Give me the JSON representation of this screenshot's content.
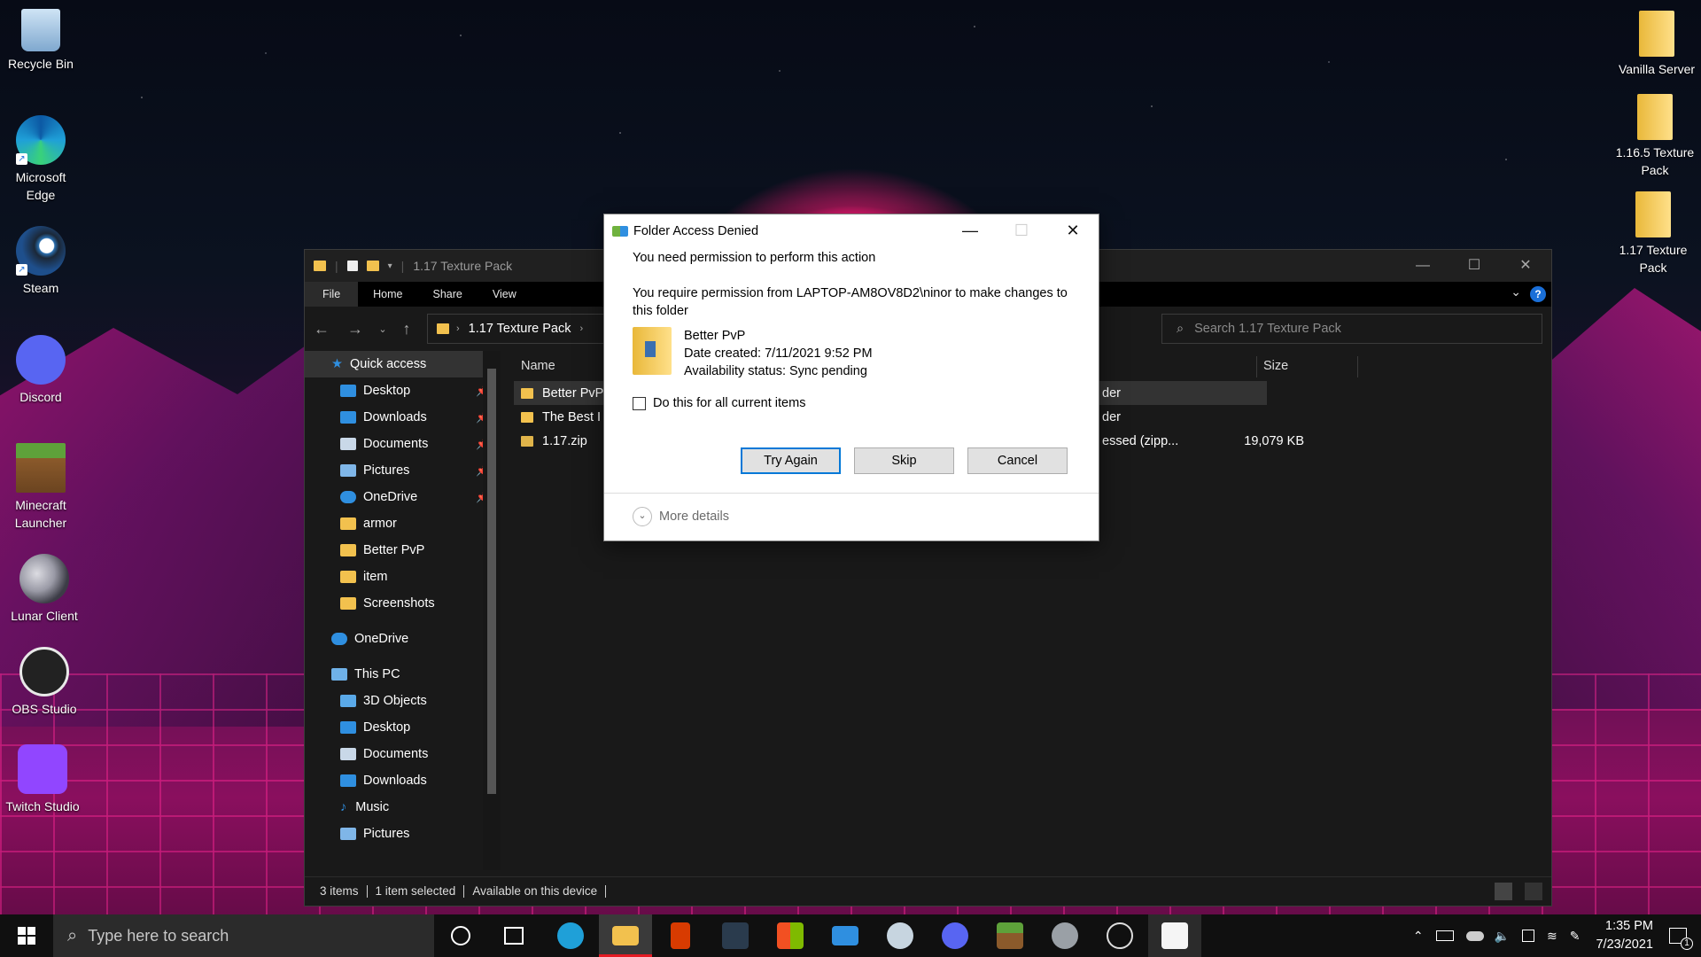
{
  "desktop": {
    "left_icons": [
      {
        "label": "Recycle Bin",
        "icon": "recycle-bin-icon",
        "color": "#9fc6e8"
      },
      {
        "label": "Microsoft Edge",
        "icon": "edge-icon",
        "color": "#1fa0d8"
      },
      {
        "label": "Steam",
        "icon": "steam-icon",
        "color": "#1b2838"
      },
      {
        "label": "Discord",
        "icon": "discord-icon",
        "color": "#5865f2"
      },
      {
        "label": "Minecraft Launcher",
        "icon": "minecraft-icon",
        "color": "#5a8f3a"
      },
      {
        "label": "Lunar Client",
        "icon": "lunar-client-icon",
        "color": "#3c3c46"
      },
      {
        "label": "OBS Studio",
        "icon": "obs-icon",
        "color": "#222222"
      },
      {
        "label": "Twitch Studio",
        "icon": "twitch-icon",
        "color": "#9146ff"
      }
    ],
    "right_icons": [
      {
        "label": "Vanilla Server",
        "icon": "folder-icon"
      },
      {
        "label": "1.16.5 Texture Pack",
        "icon": "folder-icon"
      },
      {
        "label": "1.17 Texture Pack",
        "icon": "folder-icon"
      }
    ]
  },
  "explorer": {
    "title": "1.17 Texture Pack",
    "tabs": [
      "File",
      "Home",
      "Share",
      "View"
    ],
    "address": "1.17 Texture Pack",
    "search_placeholder": "Search 1.17 Texture Pack",
    "nav": {
      "quick_access": "Quick access",
      "pinned": [
        "Desktop",
        "Downloads",
        "Documents",
        "Pictures",
        "OneDrive"
      ],
      "folders": [
        "armor",
        "Better PvP",
        "item",
        "Screenshots"
      ],
      "onedrive": "OneDrive",
      "this_pc": "This PC",
      "pc_items": [
        "3D Objects",
        "Desktop",
        "Documents",
        "Downloads",
        "Music",
        "Pictures"
      ]
    },
    "columns": {
      "name": "Name",
      "size": "Size"
    },
    "files": [
      {
        "name": "Better PvP",
        "type_frag": "der",
        "size": ""
      },
      {
        "name": "The Best I",
        "type_frag": "der",
        "size": ""
      },
      {
        "name": "1.17.zip",
        "type_frag": "essed (zipp...",
        "size": "19,079 KB"
      }
    ],
    "status": {
      "count": "3 items",
      "selected": "1 item selected",
      "availability": "Available on this device"
    }
  },
  "dialog": {
    "title": "Folder Access Denied",
    "heading": "You need permission to perform this action",
    "message": "You require permission from LAPTOP-AM8OV8D2\\ninor to make changes to this folder",
    "item_name": "Better PvP",
    "item_date": "Date created: 7/11/2021 9:52 PM",
    "item_status": "Availability status: Sync pending",
    "checkbox_label": "Do this for all current items",
    "buttons": {
      "try_again": "Try Again",
      "skip": "Skip",
      "cancel": "Cancel"
    },
    "more_details": "More details"
  },
  "taskbar": {
    "search_placeholder": "Type here to search",
    "time": "1:35 PM",
    "date": "7/23/2021",
    "notifications": "1",
    "apps": [
      {
        "name": "edge-icon",
        "color": "#1fa0d8"
      },
      {
        "name": "file-explorer-icon",
        "color": "#f2c14e"
      },
      {
        "name": "office-icon",
        "color": "#d83b01"
      },
      {
        "name": "predator-sense-icon",
        "color": "#2a3b4d"
      },
      {
        "name": "store-icon",
        "color": "#ffffff"
      },
      {
        "name": "mail-icon",
        "color": "#2f8fe0"
      },
      {
        "name": "steam-icon",
        "color": "#c7d5e0"
      },
      {
        "name": "discord-icon",
        "color": "#5865f2"
      },
      {
        "name": "minecraft-icon",
        "color": "#5a8f3a"
      },
      {
        "name": "lunar-client-icon",
        "color": "#9aa0a6"
      },
      {
        "name": "obs-icon",
        "color": "#dddddd"
      },
      {
        "name": "java-icon",
        "color": "#f5f5f5"
      }
    ]
  }
}
